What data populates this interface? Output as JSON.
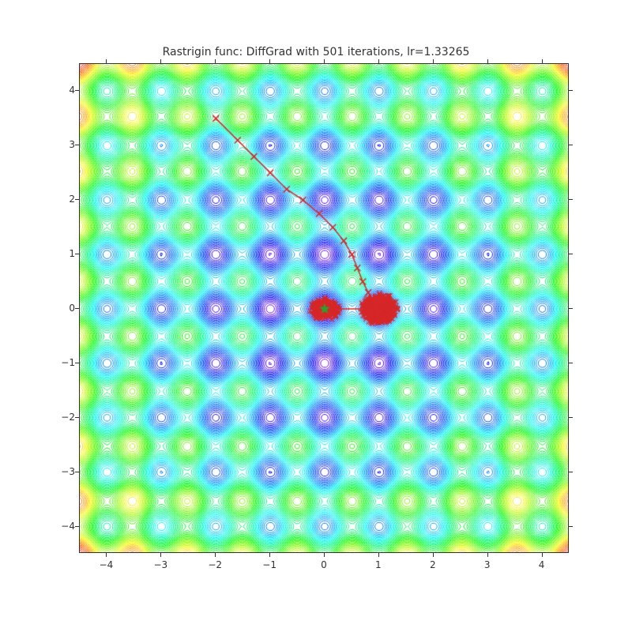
{
  "chart_data": {
    "type": "contour",
    "title": "Rastrigin func: DiffGrad with 501 iterations, lr=1.33265",
    "xlabel": "",
    "ylabel": "",
    "xlim": [
      -4.5,
      4.5
    ],
    "ylim": [
      -4.5,
      4.5
    ],
    "xticks": [
      -4,
      -3,
      -2,
      -1,
      0,
      1,
      2,
      3,
      4
    ],
    "yticks": [
      -4,
      -3,
      -2,
      -1,
      0,
      1,
      2,
      3,
      4
    ],
    "function": "Rastrigin",
    "A": 10,
    "n_dim": 2,
    "contour_levels": 60,
    "colormap": "rainbow",
    "optimizer": "DiffGrad",
    "iterations": 501,
    "learning_rate": 1.33265,
    "path_color": "#d62728",
    "path_marker": "x",
    "optimum_marker": {
      "x": 0,
      "y": 0,
      "color": "#2ca02c",
      "shape": "star"
    },
    "trajectory_keypoints": [
      {
        "x": -2.0,
        "y": 3.5
      },
      {
        "x": -1.6,
        "y": 3.1
      },
      {
        "x": -1.3,
        "y": 2.8
      },
      {
        "x": -1.0,
        "y": 2.5
      },
      {
        "x": -0.7,
        "y": 2.2
      },
      {
        "x": -0.4,
        "y": 2.0
      },
      {
        "x": -0.1,
        "y": 1.75
      },
      {
        "x": 0.15,
        "y": 1.5
      },
      {
        "x": 0.35,
        "y": 1.25
      },
      {
        "x": 0.5,
        "y": 1.0
      },
      {
        "x": 0.6,
        "y": 0.75
      },
      {
        "x": 0.7,
        "y": 0.5
      },
      {
        "x": 0.8,
        "y": 0.3
      },
      {
        "x": 0.9,
        "y": 0.15
      },
      {
        "x": 1.0,
        "y": 0.05
      }
    ],
    "dense_clusters": [
      {
        "cx": 1.0,
        "cy": 0.0,
        "rx": 0.35,
        "ry": 0.3,
        "count": 300
      },
      {
        "cx": 0.0,
        "cy": 0.0,
        "rx": 0.28,
        "ry": 0.22,
        "count": 180
      }
    ]
  },
  "ui": {
    "xtick_labels": [
      "−4",
      "−3",
      "−2",
      "−1",
      "0",
      "1",
      "2",
      "3",
      "4"
    ],
    "ytick_labels": [
      "−4",
      "−3",
      "−2",
      "−1",
      "0",
      "1",
      "2",
      "3",
      "4"
    ]
  }
}
